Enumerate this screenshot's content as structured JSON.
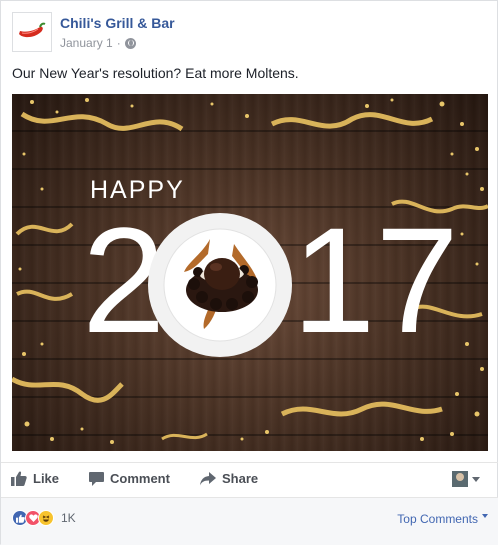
{
  "post": {
    "page_name": "Chili's Grill & Bar",
    "date": "January 1",
    "separator": "·",
    "text": "Our New Year's resolution? Eat more Moltens."
  },
  "hero": {
    "happy": "HAPPY",
    "year_left": "2",
    "year_right": "17",
    "bg_color": "#4a3224",
    "confetti_color": "#d9b35a"
  },
  "actions": {
    "like": "Like",
    "comment": "Comment",
    "share": "Share"
  },
  "footer": {
    "reaction_count": "1K",
    "top_comments": "Top Comments"
  },
  "colors": {
    "link_blue": "#365899",
    "accent_blue": "#4267b2",
    "muted_gray": "#90949c",
    "chilis_red": "#d52b1e"
  }
}
